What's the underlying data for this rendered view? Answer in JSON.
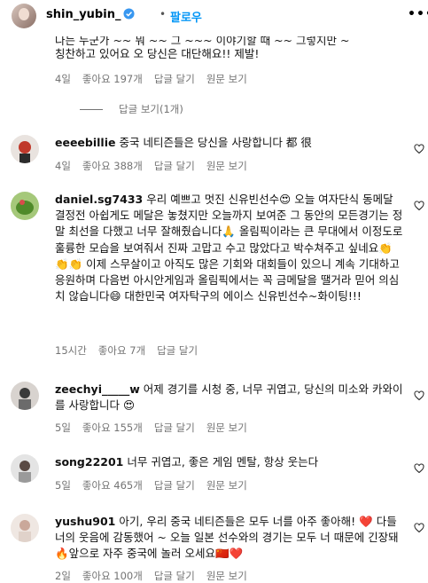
{
  "header": {
    "username": "shin_yubin_",
    "follow_label": "팔로우",
    "more": "•••"
  },
  "partial_comment": {
    "line1": "나는 누군가 ~~ 뭐 ~~ 그 ~~~ 이야기할 때 ~~ 그렇지만 ~",
    "line2": "칭찬하고 있어요 오 당신은 대단해요!! 제발!",
    "time": "4일",
    "likes": "좋아요 197개",
    "reply": "답글 달기",
    "original": "원문 보기"
  },
  "view_replies": "답글 보기(1개)",
  "comments": [
    {
      "user": "eeeebillie",
      "text": "중국 네티즌들은 당신을 사랑합니다 都 很",
      "time": "4일",
      "likes": "좋아요 388개",
      "reply": "답글 달기",
      "original": "원문 보기"
    },
    {
      "user": "daniel.sg7433",
      "text": "우리 예쁘고 멋진 신유빈선수😍 오늘 여자단식 동메달 결정전 아쉽게도 메달은 놓쳤지만 오늘까지 보여준 그 동안의 모든경기는 정말 최선을 다했고 너무 잘해줬습니다🙏 올림픽이라는 큰 무대에서 이정도로 훌륭한 모습을 보여줘서 진짜 고맙고 수고 많았다고 박수쳐주고 싶네요👏👏👏 이제 스무살이고 아직도 많은 기회와 대회들이 있으니 계속 기대하고 응원하며 다음번 아시안게임과 올림픽에서는 꼭 금메달을 땔거라 믿어 의심치 않습니다😄 대한민국 여자탁구의 에이스 신유빈선수~화이팅!!!",
      "time": "15시간",
      "likes": "좋아요 7개",
      "reply": "답글 달기",
      "original": ""
    },
    {
      "user": "zeechyi_____w",
      "text": "어제 경기를 시청 중, 너무 귀엽고, 당신의 미소와 카와이를 사랑합니다 😍",
      "time": "5일",
      "likes": "좋아요 155개",
      "reply": "답글 달기",
      "original": "원문 보기"
    },
    {
      "user": "song22201",
      "text": "너무 귀엽고, 좋은 게임 멘탈, 항상 웃는다",
      "time": "5일",
      "likes": "좋아요 465개",
      "reply": "답글 달기",
      "original": "원문 보기"
    },
    {
      "user": "yushu901",
      "text": "아기, 우리 중국 네티즌들은 모두 너를 아주 좋아해! ❤️ 다들 너의 웃음에 감동했어 ~ 오늘 일본 선수와의 경기는 모두 너 때문에 긴장돼🔥앞으로 자주 중국에 놀러 오세요🇨🇳❤️",
      "time": "2일",
      "likes": "좋아요 100개",
      "reply": "답글 달기",
      "original": "원문 보기"
    }
  ],
  "colors": {
    "link": "#0095f6",
    "secondary": "#737373",
    "verified": "#3897f0"
  },
  "icons": {
    "verified": "verified-badge-icon",
    "heart": "heart-outline-icon",
    "more": "more-options-icon"
  }
}
